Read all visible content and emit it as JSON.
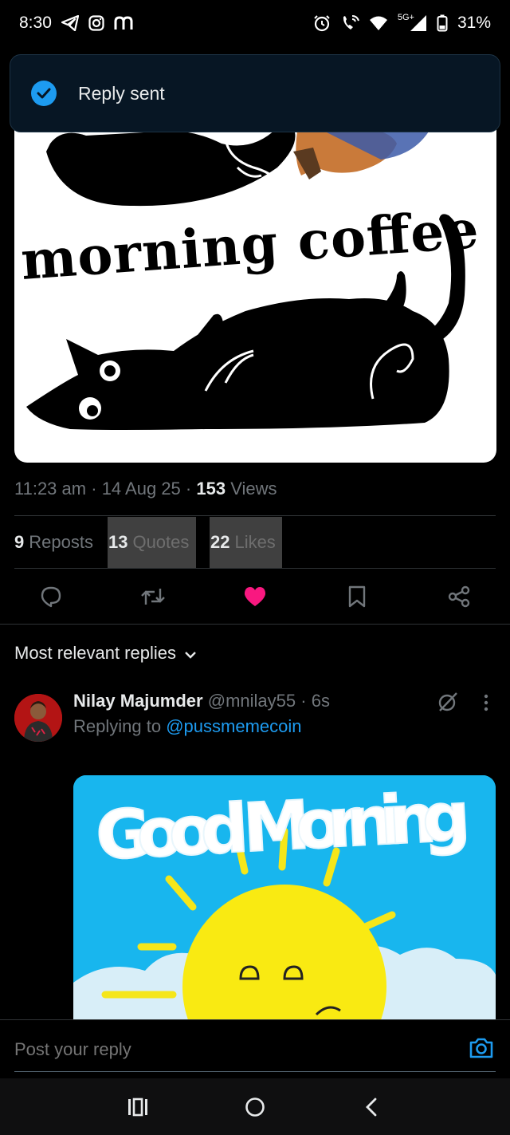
{
  "status_bar": {
    "time": "8:30",
    "network": "5G+",
    "battery": "31%",
    "icons": [
      "telegram-icon",
      "instagram-icon",
      "m-app-icon",
      "alarm-icon",
      "wifi-calling-icon",
      "wifi-icon",
      "signal-icon",
      "battery-icon"
    ]
  },
  "toast": {
    "message": "Reply sent",
    "icon": "check-circle-icon",
    "accent": "#1d9bf0"
  },
  "post": {
    "image_caption_text": "morning coffee",
    "time": "11:23 am",
    "date": "14 Aug 25",
    "views_count": "153",
    "views_label": "Views",
    "reposts_count": "9",
    "reposts_label": "Reposts",
    "quotes_count": "13",
    "quotes_label": "Quotes",
    "likes_count": "22",
    "likes_label": "Likes",
    "liked": true,
    "like_color": "#f91880"
  },
  "actions": [
    "reply-icon",
    "repost-icon",
    "like-icon",
    "bookmark-icon",
    "share-icon"
  ],
  "replies_sort": {
    "label": "Most relevant replies"
  },
  "reply": {
    "name": "Nilay Majumder",
    "handle": "@mnilay55",
    "time": "6s",
    "replying_prefix": "Replying to",
    "replying_to": "@pussmemecoin",
    "image_text": "Good Morning"
  },
  "composer": {
    "placeholder": "Post your reply"
  },
  "colors": {
    "background": "#000000",
    "accent": "#1d9bf0",
    "muted": "#71767b",
    "divider": "#2f3336"
  }
}
